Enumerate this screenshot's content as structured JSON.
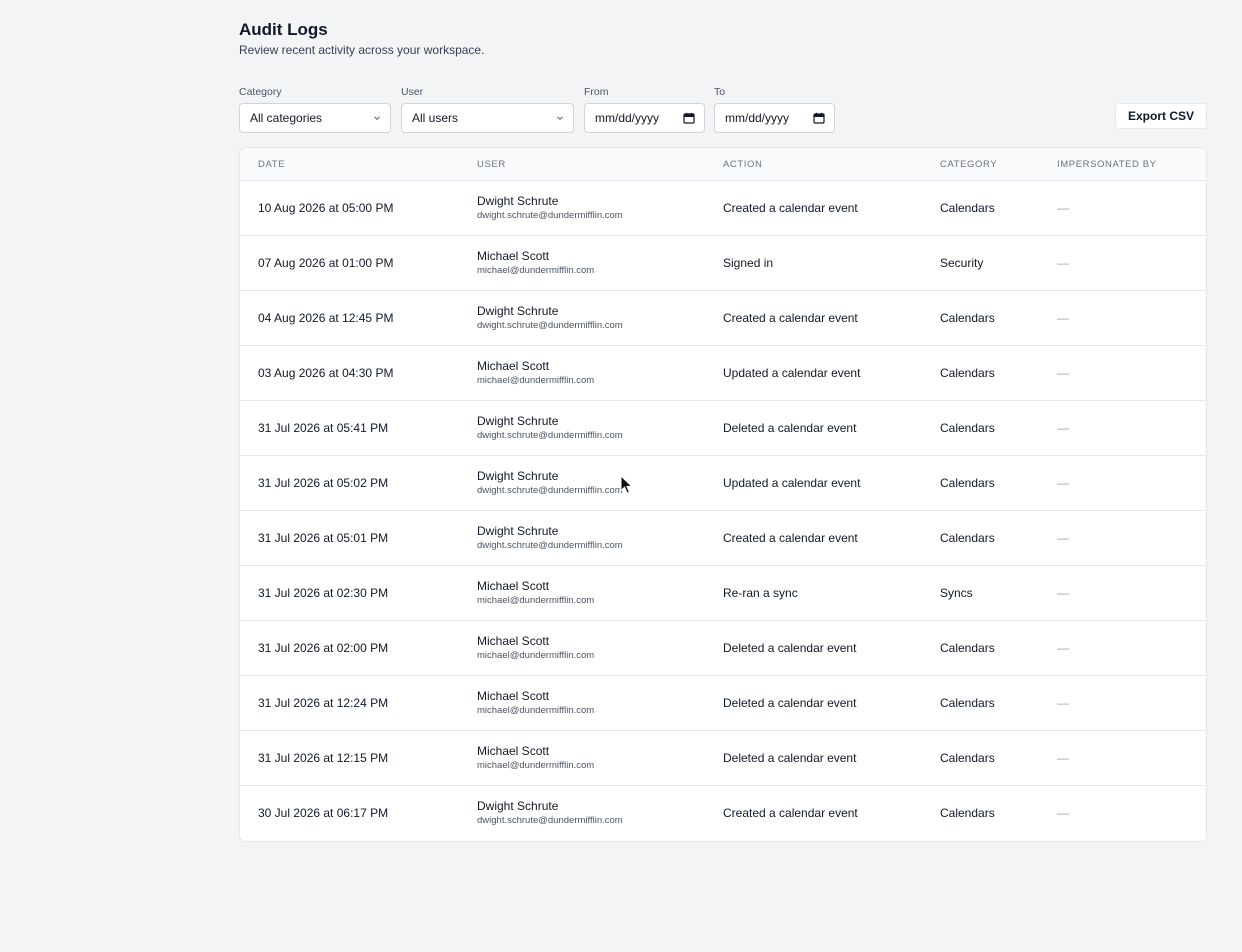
{
  "header": {
    "title": "Audit Logs",
    "subtitle": "Review recent activity across your workspace."
  },
  "filters": {
    "category": {
      "label": "Category",
      "value": "All categories"
    },
    "user": {
      "label": "User",
      "value": "All users"
    },
    "from": {
      "label": "From",
      "value": "mm/dd/yyyy"
    },
    "to": {
      "label": "To",
      "value": "mm/dd/yyyy"
    }
  },
  "toolbar": {
    "export_label": "Export CSV"
  },
  "table": {
    "columns": [
      "DATE",
      "USER",
      "ACTION",
      "CATEGORY",
      "IMPERSONATED BY"
    ],
    "rows": [
      {
        "date": "10 Aug 2026 at 05:00 PM",
        "user_name": "Dwight Schrute",
        "user_email": "dwight.schrute@dundermifflin.com",
        "action": "Created a calendar event",
        "category": "Calendars",
        "impersonated_by": "—"
      },
      {
        "date": "07 Aug 2026 at 01:00 PM",
        "user_name": "Michael Scott",
        "user_email": "michael@dundermifflin.com",
        "action": "Signed in",
        "category": "Security",
        "impersonated_by": "—"
      },
      {
        "date": "04 Aug 2026 at 12:45 PM",
        "user_name": "Dwight Schrute",
        "user_email": "dwight.schrute@dundermifflin.com",
        "action": "Created a calendar event",
        "category": "Calendars",
        "impersonated_by": "—"
      },
      {
        "date": "03 Aug 2026 at 04:30 PM",
        "user_name": "Michael Scott",
        "user_email": "michael@dundermifflin.com",
        "action": "Updated a calendar event",
        "category": "Calendars",
        "impersonated_by": "—"
      },
      {
        "date": "31 Jul 2026 at 05:41 PM",
        "user_name": "Dwight Schrute",
        "user_email": "dwight.schrute@dundermifflin.com",
        "action": "Deleted a calendar event",
        "category": "Calendars",
        "impersonated_by": "—"
      },
      {
        "date": "31 Jul 2026 at 05:02 PM",
        "user_name": "Dwight Schrute",
        "user_email": "dwight.schrute@dundermifflin.com",
        "action": "Updated a calendar event",
        "category": "Calendars",
        "impersonated_by": "—"
      },
      {
        "date": "31 Jul 2026 at 05:01 PM",
        "user_name": "Dwight Schrute",
        "user_email": "dwight.schrute@dundermifflin.com",
        "action": "Created a calendar event",
        "category": "Calendars",
        "impersonated_by": "—"
      },
      {
        "date": "31 Jul 2026 at 02:30 PM",
        "user_name": "Michael Scott",
        "user_email": "michael@dundermifflin.com",
        "action": "Re-ran a sync",
        "category": "Syncs",
        "impersonated_by": "—"
      },
      {
        "date": "31 Jul 2026 at 02:00 PM",
        "user_name": "Michael Scott",
        "user_email": "michael@dundermifflin.com",
        "action": "Deleted a calendar event",
        "category": "Calendars",
        "impersonated_by": "—"
      },
      {
        "date": "31 Jul 2026 at 12:24 PM",
        "user_name": "Michael Scott",
        "user_email": "michael@dundermifflin.com",
        "action": "Deleted a calendar event",
        "category": "Calendars",
        "impersonated_by": "—"
      },
      {
        "date": "31 Jul 2026 at 12:15 PM",
        "user_name": "Michael Scott",
        "user_email": "michael@dundermifflin.com",
        "action": "Deleted a calendar event",
        "category": "Calendars",
        "impersonated_by": "—"
      },
      {
        "date": "30 Jul 2026 at 06:17 PM",
        "user_name": "Dwight Schrute",
        "user_email": "dwight.schrute@dundermifflin.com",
        "action": "Created a calendar event",
        "category": "Calendars",
        "impersonated_by": "—"
      }
    ]
  },
  "icons": {
    "select": "chevron-down-icon",
    "date": "calendar-icon",
    "pointer": "mouse-cursor-icon"
  }
}
